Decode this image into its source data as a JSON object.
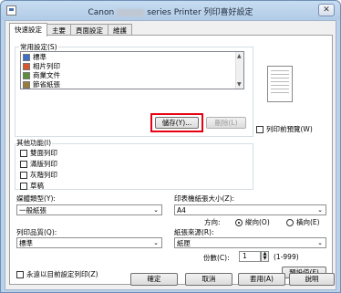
{
  "window": {
    "title_prefix": "Canon",
    "title_suffix": "series Printer 列印喜好設定",
    "close_glyph": "✕"
  },
  "tabs": [
    {
      "label": "快速設定",
      "active": true
    },
    {
      "label": "主要"
    },
    {
      "label": "頁面設定"
    },
    {
      "label": "維護"
    }
  ],
  "common_settings": {
    "label": "常用設定(S)",
    "items": [
      {
        "label": "標準",
        "icon": "standard-icon",
        "color": "#3b6fc9"
      },
      {
        "label": "相片列印",
        "icon": "photo-icon",
        "color": "#d9552b"
      },
      {
        "label": "商業文件",
        "icon": "business-document-icon",
        "color": "#5b8f3a"
      },
      {
        "label": "節省紙張",
        "icon": "paper-saving-icon",
        "color": "#9a7d3a"
      }
    ],
    "save_label": "儲存(Y)...",
    "delete_label": "刪除(L)"
  },
  "preview_label": "列印前預覽(W)",
  "additional_features": {
    "label": "其他功能(I)",
    "options": [
      "雙面列印",
      "滿版列印",
      "灰階列印",
      "草稿"
    ]
  },
  "media_type": {
    "label": "媒體類型(Y):",
    "value": "一般紙張"
  },
  "printer_paper_size": {
    "label": "印表機紙張大小(Z):",
    "value": "A4"
  },
  "orientation": {
    "label": "方向:",
    "portrait": "縱向(O)",
    "landscape": "橫向(E)",
    "selected": "portrait"
  },
  "print_quality": {
    "label": "列印品質(Q):",
    "value": "標準"
  },
  "paper_source": {
    "label": "紙張來源(R):",
    "value": "紙匣"
  },
  "copies": {
    "label": "份數(C):",
    "value": "1",
    "range": "(1-999)"
  },
  "always_print_label": "永遠以目前設定列印(Z)",
  "defaults_label": "預設值(F)",
  "footer": {
    "ok": "確定",
    "cancel": "取消",
    "apply": "套用(A)",
    "help": "說明"
  },
  "colors": {
    "highlight": "#e60012",
    "title_bg": "#b9d1ea"
  }
}
